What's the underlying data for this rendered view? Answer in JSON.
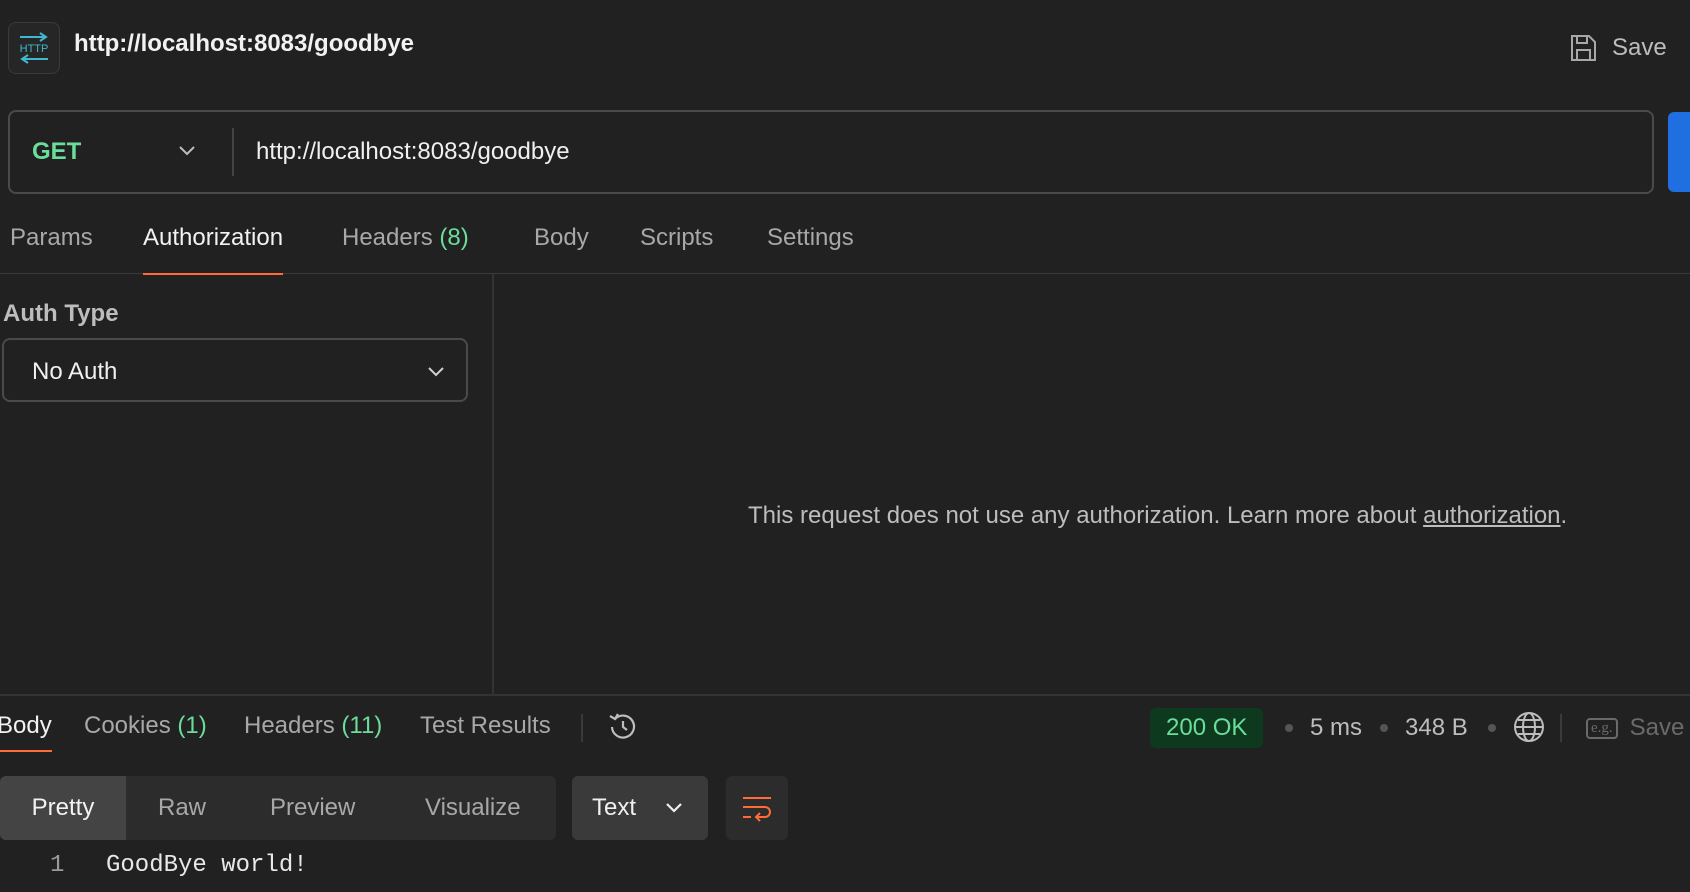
{
  "header": {
    "badge_text": "HTTP",
    "title": "http://localhost:8083/goodbye",
    "save_label": "Save"
  },
  "request": {
    "method": "GET",
    "url": "http://localhost:8083/goodbye"
  },
  "request_tabs": {
    "params": "Params",
    "authorization": "Authorization",
    "headers": "Headers",
    "headers_count": "(8)",
    "body": "Body",
    "scripts": "Scripts",
    "settings": "Settings",
    "active": "Authorization"
  },
  "auth": {
    "label": "Auth Type",
    "type": "No Auth",
    "message": "This request does not use any authorization. Learn more about ",
    "link_text": "authorization",
    "message_end": "."
  },
  "response_tabs": {
    "body": "Body",
    "cookies": "Cookies",
    "cookies_count": "(1)",
    "headers": "Headers",
    "headers_count": "(11)",
    "test_results": "Test Results"
  },
  "response_meta": {
    "status": "200 OK",
    "time": "5 ms",
    "size": "348 B",
    "save_label": "Save",
    "example_icon_text": "e.g."
  },
  "view_modes": {
    "pretty": "Pretty",
    "raw": "Raw",
    "preview": "Preview",
    "visualize": "Visualize",
    "format": "Text"
  },
  "response_body": {
    "lines": [
      {
        "number": "1",
        "text": "GoodBye world!"
      }
    ]
  },
  "colors": {
    "background": "#212121",
    "method_green": "#6bdd9a",
    "accent_orange": "#ff6c37",
    "send_blue": "#1f6fe0",
    "status_bg": "#0d3a1f"
  }
}
